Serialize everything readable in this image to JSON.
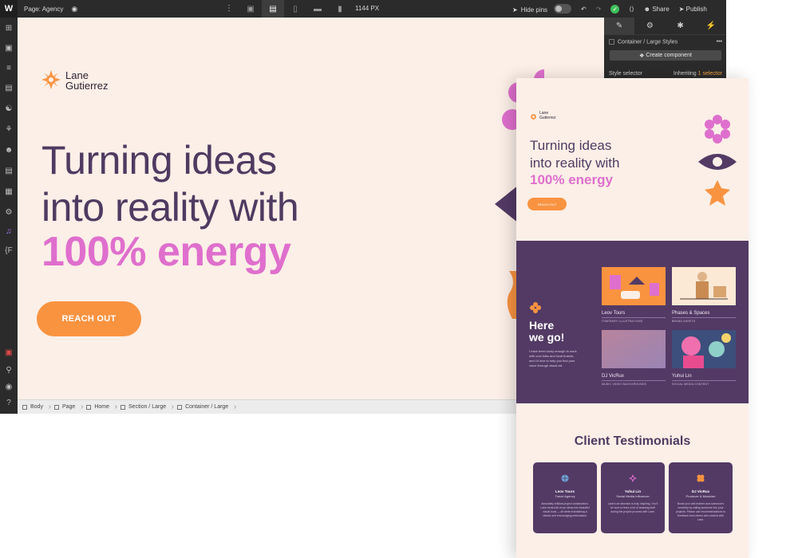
{
  "topbar": {
    "logo": "W",
    "page_label": "Page: Agency",
    "width_label": "1144 PX",
    "hide_pins_label": "Hide pins",
    "share_label": "Share",
    "publish_label": "Publish"
  },
  "right_panel": {
    "element_label": "Container / Large Styles",
    "create_component_label": "Create component",
    "style_selector_label": "Style selector",
    "inheriting_prefix": "Inheriting",
    "inheriting_count": "1 selector"
  },
  "canvas": {
    "logo_first": "Lane",
    "logo_last": "Gutierrez",
    "hero_line1": "Turning ideas",
    "hero_line2": "into reality with",
    "hero_line3": "100% energy",
    "cta_label": "REACH OUT"
  },
  "breadcrumb": [
    "Body",
    "Page",
    "Home",
    "Section / Large",
    "Container / Large"
  ],
  "preview": {
    "logo_first": "Lane",
    "logo_last": "Gutierrez",
    "hero_line1": "Turning ideas",
    "hero_line2": "into reality with",
    "hero_line3": "100% energy",
    "cta_label": "REACH OUT",
    "here_we_go_line1": "Here",
    "here_we_go_line2": "we go!",
    "here_we_go_desc": "I have been lucky enough to work with cool folks and local brands, and I'd love to help you find your voice through visual art.",
    "projects": [
      {
        "name": "Leov Tours",
        "tag": "ITINERARY ILLUSTRATIONS"
      },
      {
        "name": "Phases & Spaces",
        "tag": "BRAND ASSETS"
      },
      {
        "name": "DJ VicRux",
        "tag": "MUSIC VIDEO BACKGROUNDS"
      },
      {
        "name": "Yuhui Lin",
        "tag": "SOCIAL MEDIA CONTENT"
      }
    ],
    "testimonials_title": "Client Testimonials",
    "testimonials": [
      {
        "name": "Leov Tours",
        "role": "Travel Agency",
        "quote": "Absolutely brilliant project collaboration. Lane turned all of our ideas into beautiful visual tools — all while maintaining a vibrant and encouraging enthusiasm."
      },
      {
        "name": "Yuhui Lin",
        "role": "Social Media Influencer",
        "quote": "Lane's art direction is truly inspiring. You'll be sure to learn a lot of amazing stuff during the project process with Lane."
      },
      {
        "name": "DJ VicRux",
        "role": "Producer & Musician",
        "quote": "Boost your self-esteem and someone's creativity by calling someone into your projects. Please use recommendations to feedback from others who worked with Lane."
      }
    ]
  },
  "colors": {
    "cream": "#fcefe7",
    "purple": "#533a65",
    "pink": "#df6fcd",
    "orange": "#f99340",
    "chrome": "#2b2b2b"
  }
}
